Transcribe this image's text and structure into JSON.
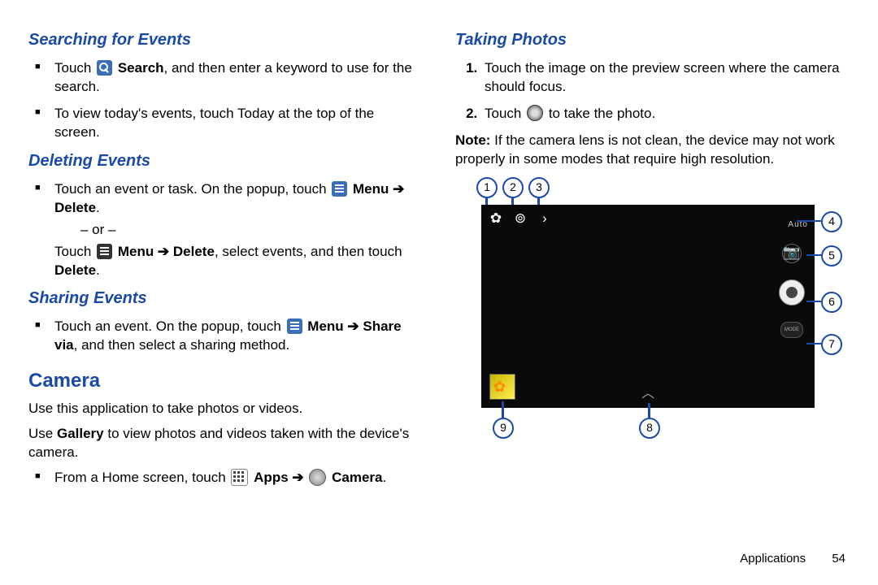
{
  "left": {
    "h_search": "Searching for Events",
    "search_b1a": "Touch ",
    "search_b1b": "Search",
    "search_b1c": ", and then enter a keyword to use for the search.",
    "search_b2": "To view today's events, touch Today at the top of the screen.",
    "h_delete": "Deleting Events",
    "del_b1a": "Touch an event or task. On the popup, touch ",
    "del_menu": "Menu",
    "del_arrow": " ➔ ",
    "del_delete": "Delete",
    "del_period": ".",
    "del_or": "– or –",
    "del_b2a": "Touch ",
    "del_b2b": "Menu ➔ Delete",
    "del_b2c": ", select events, and then touch ",
    "del_b2d": "Delete",
    "h_share": "Sharing Events",
    "share_b1a": "Touch an event. On the popup, touch ",
    "share_menu": "Menu ➔ ",
    "share_via": "Share via",
    "share_b1b": ", and then select a sharing method.",
    "h_camera": "Camera",
    "cam_p1": "Use this application to take photos or videos.",
    "cam_p2a": "Use ",
    "cam_p2b": "Gallery",
    "cam_p2c": " to view photos and videos taken with the device's camera.",
    "cam_b1a": "From a Home screen, touch ",
    "cam_apps": "Apps ➔ ",
    "cam_camera": "Camera",
    "cam_b1end": "."
  },
  "right": {
    "h_taking": "Taking Photos",
    "tp1": "Touch the image on the preview screen where the camera should focus.",
    "tp2a": "Touch ",
    "tp2b": " to take the photo.",
    "note_label": "Note: ",
    "note_text": "If the camera lens is not clean, the device may not work properly in some modes that require high resolution.",
    "auto_label": "Auto",
    "mode_label": "MODE"
  },
  "callouts": {
    "c1": "1",
    "c2": "2",
    "c3": "3",
    "c4": "4",
    "c5": "5",
    "c6": "6",
    "c7": "7",
    "c8": "8",
    "c9": "9"
  },
  "footer": {
    "section": "Applications",
    "page": "54"
  }
}
